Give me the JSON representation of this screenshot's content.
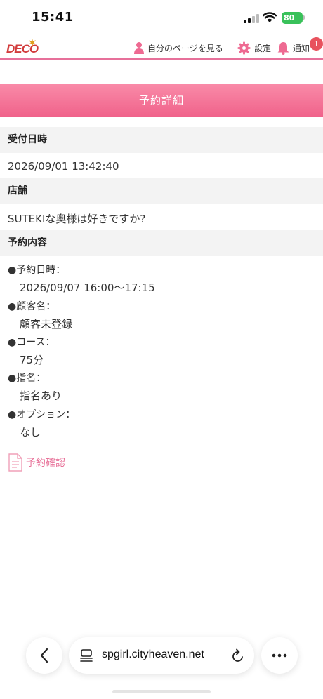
{
  "status": {
    "time": "15:41",
    "battery": "80"
  },
  "header": {
    "logo": "DECO",
    "mypage_label": "自分のページを見る",
    "settings_label": "設定",
    "notice_label": "通知",
    "notice_badge": "1"
  },
  "page": {
    "title": "予約詳細"
  },
  "received": {
    "label": "受付日時",
    "value": "2026/09/01 13:42:40"
  },
  "store": {
    "label": "店舗",
    "value": "SUTEKIな奥様は好きですか?"
  },
  "content": {
    "label": "予約内容",
    "items": [
      {
        "label": "●予約日時：",
        "value": "2026/09/07 16:00～17:15"
      },
      {
        "label": "●顧客名：",
        "value": "顧客未登録"
      },
      {
        "label": "●コース：",
        "value": "75分"
      },
      {
        "label": "●指名：",
        "value": "指名あり"
      },
      {
        "label": "●オプション：",
        "value": "なし"
      }
    ]
  },
  "confirm_link": "予約確認",
  "browser": {
    "url": "spgirl.cityheaven.net"
  },
  "colors": {
    "accent": "#f0628a",
    "link": "#e8739a",
    "badge": "#e8525d"
  },
  "icons": [
    "person-icon",
    "gear-icon",
    "bell-icon",
    "document-icon",
    "chevron-left-icon",
    "tabs-icon",
    "reload-icon",
    "more-icon"
  ]
}
